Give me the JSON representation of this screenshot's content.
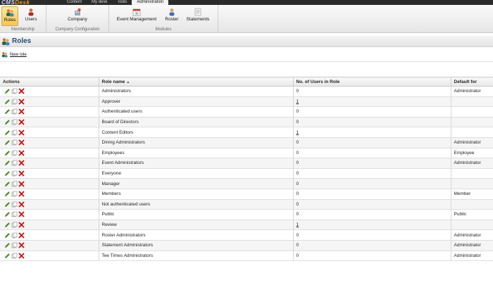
{
  "top_nav": {
    "logo_a": "CMS",
    "logo_b": "Desk",
    "tabs": [
      "Content",
      "My desk",
      "Tools",
      "Administration"
    ]
  },
  "ribbon": {
    "membership": {
      "title": "Membership",
      "roles": "Roles",
      "users": "Users"
    },
    "company": {
      "title": "Company Configuration",
      "company": "Company"
    },
    "modules": {
      "title": "Modules",
      "event": "Event Management",
      "roster": "Roster",
      "statements": "Statements"
    }
  },
  "page": {
    "title": "Roles",
    "new_role": "New role"
  },
  "table": {
    "headers": [
      "Actions",
      "Role name",
      "No. of Users in Role",
      "Default for"
    ],
    "rows": [
      {
        "name": "Administrators",
        "users": "0",
        "default": "Administrator"
      },
      {
        "name": "Approver",
        "users": "1",
        "default": ""
      },
      {
        "name": "Authenticated users",
        "users": "0",
        "default": ""
      },
      {
        "name": "Board of Directors",
        "users": "0",
        "default": ""
      },
      {
        "name": "Content Editors",
        "users": "1",
        "default": ""
      },
      {
        "name": "Dining Administrators",
        "users": "0",
        "default": "Administrator"
      },
      {
        "name": "Employees",
        "users": "0",
        "default": "Employee"
      },
      {
        "name": "Event Administrators",
        "users": "0",
        "default": "Administrator"
      },
      {
        "name": "Everyone",
        "users": "0",
        "default": ""
      },
      {
        "name": "Manager",
        "users": "0",
        "default": ""
      },
      {
        "name": "Members",
        "users": "0",
        "default": "Member"
      },
      {
        "name": "Not authenticated users",
        "users": "0",
        "default": ""
      },
      {
        "name": "Public",
        "users": "0",
        "default": "Public"
      },
      {
        "name": "Review",
        "users": "1",
        "default": ""
      },
      {
        "name": "Roster Administrators",
        "users": "0",
        "default": "Administrator"
      },
      {
        "name": "Statement Administrators",
        "users": "0",
        "default": "Administrator"
      },
      {
        "name": "Tee Times Administrators",
        "users": "0",
        "default": "Administrator"
      }
    ]
  },
  "colors": {
    "accent": "#2a4a78",
    "active_ribbon": "#f3c653",
    "delete": "#cc1111",
    "edit": "#3a8a22"
  }
}
